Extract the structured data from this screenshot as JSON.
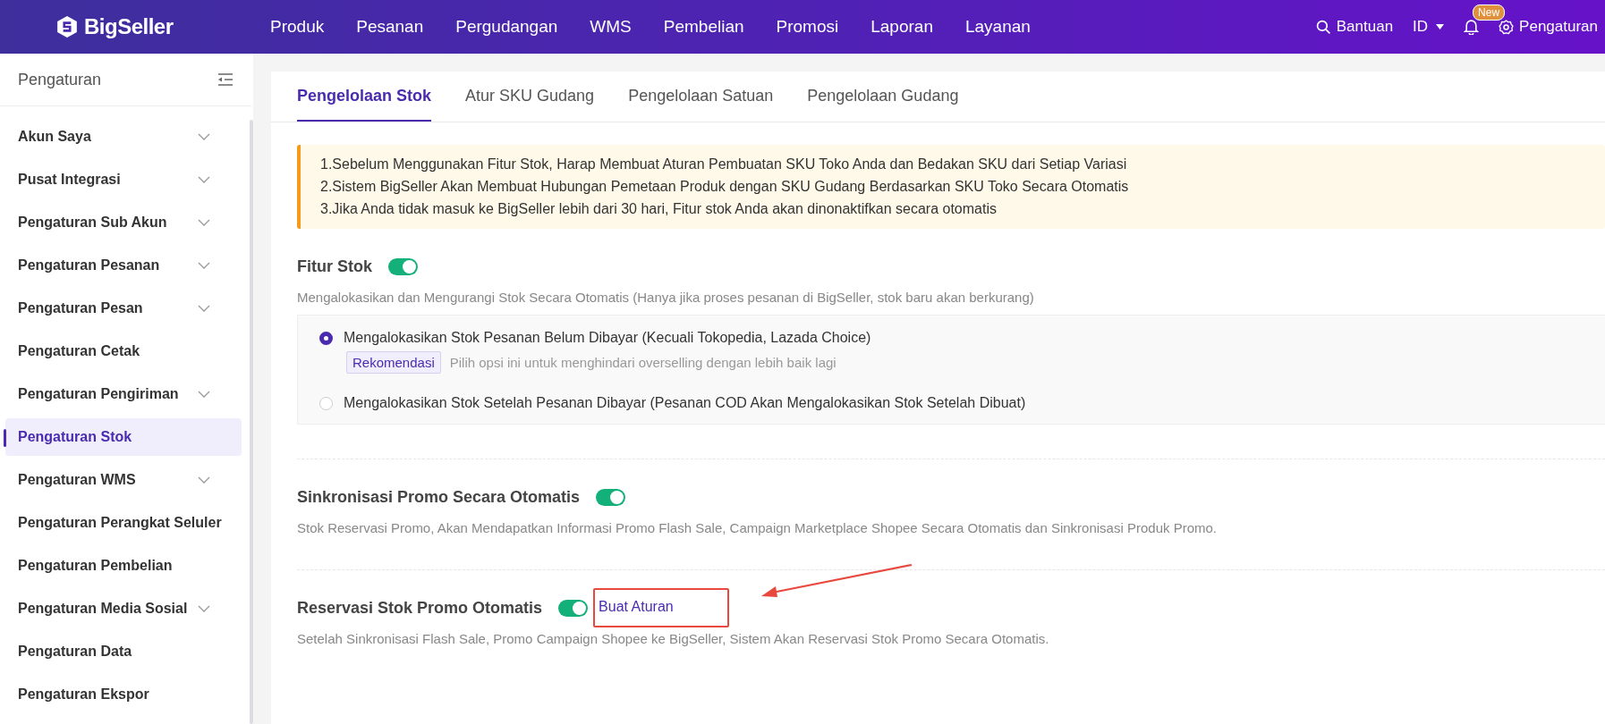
{
  "header": {
    "logo": "BigSeller",
    "nav": [
      "Produk",
      "Pesanan",
      "Pergudangan",
      "WMS",
      "Pembelian",
      "Promosi",
      "Laporan",
      "Layanan"
    ],
    "help": "Bantuan",
    "language": "ID",
    "notification_badge": "New",
    "settings": "Pengaturan"
  },
  "sidebar": {
    "title": "Pengaturan",
    "items": [
      {
        "label": "Akun Saya",
        "expandable": true,
        "selected": false
      },
      {
        "label": "Pusat Integrasi",
        "expandable": true,
        "selected": false
      },
      {
        "label": "Pengaturan Sub Akun",
        "expandable": true,
        "selected": false
      },
      {
        "label": "Pengaturan Pesanan",
        "expandable": true,
        "selected": false
      },
      {
        "label": "Pengaturan Pesan",
        "expandable": true,
        "selected": false
      },
      {
        "label": "Pengaturan Cetak",
        "expandable": false,
        "selected": false
      },
      {
        "label": "Pengaturan Pengiriman",
        "expandable": true,
        "selected": false
      },
      {
        "label": "Pengaturan Stok",
        "expandable": false,
        "selected": true
      },
      {
        "label": "Pengaturan WMS",
        "expandable": true,
        "selected": false
      },
      {
        "label": "Pengaturan Perangkat Seluler",
        "expandable": false,
        "selected": false
      },
      {
        "label": "Pengaturan Pembelian",
        "expandable": false,
        "selected": false
      },
      {
        "label": "Pengaturan Media Sosial",
        "expandable": true,
        "selected": false
      },
      {
        "label": "Pengaturan Data",
        "expandable": false,
        "selected": false
      },
      {
        "label": "Pengaturan Ekspor",
        "expandable": false,
        "selected": false
      }
    ]
  },
  "tabs": [
    {
      "label": "Pengelolaan Stok",
      "selected": true
    },
    {
      "label": "Atur SKU Gudang",
      "selected": false
    },
    {
      "label": "Pengelolaan Satuan",
      "selected": false
    },
    {
      "label": "Pengelolaan Gudang",
      "selected": false
    }
  ],
  "notice": [
    "1.Sebelum Menggunakan Fitur Stok, Harap Membuat Aturan Pembuatan SKU Toko Anda dan Bedakan SKU dari Setiap Variasi",
    "2.Sistem BigSeller Akan Membuat Hubungan Pemetaan Produk dengan SKU Gudang Berdasarkan SKU Toko Secara Otomatis",
    "3.Jika Anda tidak masuk ke BigSeller lebih dari 30 hari, Fitur stok Anda akan dinonaktifkan secara otomatis"
  ],
  "sections": [
    {
      "title": "Fitur Stok",
      "on": true,
      "description": "Mengalokasikan dan Mengurangi Stok Secara Otomatis (Hanya jika proses pesanan di BigSeller, stok baru akan berkurang)",
      "options": [
        {
          "label": "Mengalokasikan Stok Pesanan Belum Dibayar (Kecuali Tokopedia, Lazada Choice)",
          "selected": true,
          "tag": "Rekomendasi",
          "hint": "Pilih opsi ini untuk menghindari overselling dengan lebih baik lagi"
        },
        {
          "label": "Mengalokasikan Stok Setelah Pesanan Dibayar (Pesanan COD Akan Mengalokasikan Stok Setelah Dibuat)",
          "selected": false
        }
      ]
    },
    {
      "title": "Sinkronisasi Promo Secara Otomatis",
      "on": true,
      "description": "Stok Reservasi Promo, Akan Mendapatkan Informasi Promo Flash Sale, Campaign Marketplace Shopee Secara Otomatis dan Sinkronisasi Produk Promo."
    },
    {
      "title": "Reservasi Stok Promo Otomatis",
      "on": true,
      "link": "Buat Aturan",
      "description": "Setelah Sinkronisasi Flash Sale, Promo Campaign Shopee ke BigSeller, Sistem Akan Reservasi Stok Promo Secara Otomatis."
    }
  ]
}
